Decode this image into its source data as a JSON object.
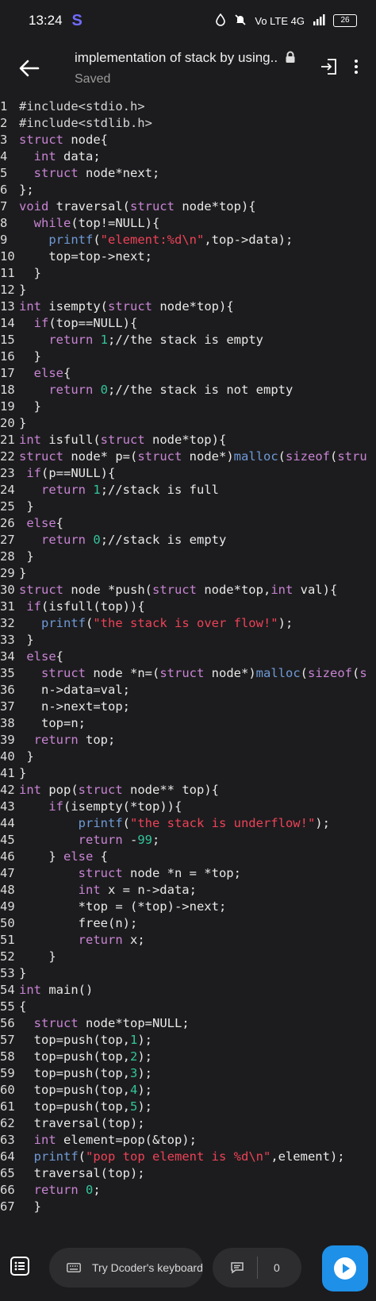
{
  "status": {
    "time": "13:24",
    "brand": "S",
    "network": "Vo LTE 4G",
    "battery": "26"
  },
  "header": {
    "title": "implementation of stack by using..",
    "subtitle": "Saved"
  },
  "icons": {
    "back": "arrow-left-icon",
    "lock": "lock-icon",
    "enter": "login-icon",
    "more": "more-vert-icon",
    "menu": "list-icon",
    "keyboard": "keyboard-icon",
    "comment": "comment-icon",
    "run": "play-icon"
  },
  "code_lines": [
    {
      "n": "1",
      "t": [
        [
          "c",
          "#include<stdio.h>"
        ]
      ]
    },
    {
      "n": "2",
      "t": [
        [
          "c",
          "#include<stdlib.h>"
        ]
      ]
    },
    {
      "n": "3",
      "t": [
        [
          "k",
          "struct"
        ],
        [
          "p",
          " node{"
        ]
      ]
    },
    {
      "n": "4",
      "t": [
        [
          "p",
          "  "
        ],
        [
          "k",
          "int"
        ],
        [
          "p",
          " data;"
        ]
      ]
    },
    {
      "n": "5",
      "t": [
        [
          "p",
          "  "
        ],
        [
          "k",
          "struct"
        ],
        [
          "p",
          " node*next;"
        ]
      ]
    },
    {
      "n": "6",
      "t": [
        [
          "p",
          "};"
        ]
      ]
    },
    {
      "n": "7",
      "t": [
        [
          "k",
          "void"
        ],
        [
          "p",
          " traversal("
        ],
        [
          "k",
          "struct"
        ],
        [
          "p",
          " node*top){"
        ]
      ]
    },
    {
      "n": "8",
      "t": [
        [
          "p",
          "  "
        ],
        [
          "k",
          "while"
        ],
        [
          "p",
          "(top!=NULL){"
        ]
      ]
    },
    {
      "n": "9",
      "t": [
        [
          "p",
          "    "
        ],
        [
          "f",
          "printf"
        ],
        [
          "p",
          "("
        ],
        [
          "s",
          "\"element:%d\\n\""
        ],
        [
          "p",
          ",top->data);"
        ]
      ]
    },
    {
      "n": "10",
      "t": [
        [
          "p",
          "    top=top->next;"
        ]
      ]
    },
    {
      "n": "11",
      "t": [
        [
          "p",
          "  }"
        ]
      ]
    },
    {
      "n": "12",
      "t": [
        [
          "p",
          "}"
        ]
      ]
    },
    {
      "n": "13",
      "t": [
        [
          "k",
          "int"
        ],
        [
          "p",
          " isempty("
        ],
        [
          "k",
          "struct"
        ],
        [
          "p",
          " node*top){"
        ]
      ]
    },
    {
      "n": "14",
      "t": [
        [
          "p",
          "  "
        ],
        [
          "k",
          "if"
        ],
        [
          "p",
          "(top==NULL){"
        ]
      ]
    },
    {
      "n": "15",
      "t": [
        [
          "p",
          "    "
        ],
        [
          "k",
          "return"
        ],
        [
          "p",
          " "
        ],
        [
          "n",
          "1"
        ],
        [
          "p",
          ";//the stack is empty"
        ]
      ]
    },
    {
      "n": "16",
      "t": [
        [
          "p",
          "  }"
        ]
      ]
    },
    {
      "n": "17",
      "t": [
        [
          "p",
          "  "
        ],
        [
          "k",
          "else"
        ],
        [
          "p",
          "{"
        ]
      ]
    },
    {
      "n": "18",
      "t": [
        [
          "p",
          "    "
        ],
        [
          "k",
          "return"
        ],
        [
          "p",
          " "
        ],
        [
          "n",
          "0"
        ],
        [
          "p",
          ";//the stack is not empty"
        ]
      ]
    },
    {
      "n": "19",
      "t": [
        [
          "p",
          "  }"
        ]
      ]
    },
    {
      "n": "20",
      "t": [
        [
          "p",
          "}"
        ]
      ]
    },
    {
      "n": "21",
      "t": [
        [
          "k",
          "int"
        ],
        [
          "p",
          " isfull("
        ],
        [
          "k",
          "struct"
        ],
        [
          "p",
          " node*top){"
        ]
      ]
    },
    {
      "n": "22",
      "t": [
        [
          "k",
          "struct"
        ],
        [
          "p",
          " node* p=("
        ],
        [
          "k",
          "struct"
        ],
        [
          "p",
          " node*)"
        ],
        [
          "f",
          "malloc"
        ],
        [
          "p",
          "("
        ],
        [
          "k",
          "sizeof"
        ],
        [
          "p",
          "("
        ],
        [
          "k",
          "stru"
        ]
      ]
    },
    {
      "n": "23",
      "t": [
        [
          "p",
          " "
        ],
        [
          "k",
          "if"
        ],
        [
          "p",
          "(p==NULL){"
        ]
      ]
    },
    {
      "n": "24",
      "t": [
        [
          "p",
          "   "
        ],
        [
          "k",
          "return"
        ],
        [
          "p",
          " "
        ],
        [
          "n",
          "1"
        ],
        [
          "p",
          ";//stack is full"
        ]
      ]
    },
    {
      "n": "25",
      "t": [
        [
          "p",
          " }"
        ]
      ]
    },
    {
      "n": "26",
      "t": [
        [
          "p",
          " "
        ],
        [
          "k",
          "else"
        ],
        [
          "p",
          "{"
        ]
      ]
    },
    {
      "n": "27",
      "t": [
        [
          "p",
          "   "
        ],
        [
          "k",
          "return"
        ],
        [
          "p",
          " "
        ],
        [
          "n",
          "0"
        ],
        [
          "p",
          ";//stack is empty"
        ]
      ]
    },
    {
      "n": "28",
      "t": [
        [
          "p",
          " }"
        ]
      ]
    },
    {
      "n": "29",
      "t": [
        [
          "p",
          "}"
        ]
      ]
    },
    {
      "n": "30",
      "t": [
        [
          "k",
          "struct"
        ],
        [
          "p",
          " node *push("
        ],
        [
          "k",
          "struct"
        ],
        [
          "p",
          " node*top,"
        ],
        [
          "k",
          "int"
        ],
        [
          "p",
          " val){"
        ]
      ]
    },
    {
      "n": "31",
      "t": [
        [
          "p",
          " "
        ],
        [
          "k",
          "if"
        ],
        [
          "p",
          "(isfull(top)){"
        ]
      ]
    },
    {
      "n": "32",
      "t": [
        [
          "p",
          "   "
        ],
        [
          "f",
          "printf"
        ],
        [
          "p",
          "("
        ],
        [
          "s",
          "\"the stack is over flow!\""
        ],
        [
          "p",
          ");"
        ]
      ]
    },
    {
      "n": "33",
      "t": [
        [
          "p",
          " }"
        ]
      ]
    },
    {
      "n": "34",
      "t": [
        [
          "p",
          " "
        ],
        [
          "k",
          "else"
        ],
        [
          "p",
          "{"
        ]
      ]
    },
    {
      "n": "35",
      "t": [
        [
          "p",
          "   "
        ],
        [
          "k",
          "struct"
        ],
        [
          "p",
          " node *n=("
        ],
        [
          "k",
          "struct"
        ],
        [
          "p",
          " node*)"
        ],
        [
          "f",
          "malloc"
        ],
        [
          "p",
          "("
        ],
        [
          "k",
          "sizeof"
        ],
        [
          "p",
          "("
        ],
        [
          "k",
          "s"
        ]
      ]
    },
    {
      "n": "36",
      "t": [
        [
          "p",
          "   n->data=val;"
        ]
      ]
    },
    {
      "n": "37",
      "t": [
        [
          "p",
          "   n->next=top;"
        ]
      ]
    },
    {
      "n": "38",
      "t": [
        [
          "p",
          "   top=n;"
        ]
      ]
    },
    {
      "n": "39",
      "t": [
        [
          "p",
          "  "
        ],
        [
          "k",
          "return"
        ],
        [
          "p",
          " top;"
        ]
      ]
    },
    {
      "n": "40",
      "t": [
        [
          "p",
          " }"
        ]
      ]
    },
    {
      "n": "41",
      "t": [
        [
          "p",
          "}"
        ]
      ]
    },
    {
      "n": "42",
      "t": [
        [
          "k",
          "int"
        ],
        [
          "p",
          " pop("
        ],
        [
          "k",
          "struct"
        ],
        [
          "p",
          " node** top){"
        ]
      ]
    },
    {
      "n": "43",
      "t": [
        [
          "p",
          "    "
        ],
        [
          "k",
          "if"
        ],
        [
          "p",
          "(isempty(*top)){"
        ]
      ]
    },
    {
      "n": "44",
      "t": [
        [
          "p",
          "        "
        ],
        [
          "f",
          "printf"
        ],
        [
          "p",
          "("
        ],
        [
          "s",
          "\"the stack is underflow!\""
        ],
        [
          "p",
          ");"
        ]
      ]
    },
    {
      "n": "45",
      "t": [
        [
          "p",
          "        "
        ],
        [
          "k",
          "return"
        ],
        [
          "p",
          " -"
        ],
        [
          "n",
          "99"
        ],
        [
          "p",
          ";"
        ]
      ]
    },
    {
      "n": "46",
      "t": [
        [
          "p",
          "    } "
        ],
        [
          "k",
          "else"
        ],
        [
          "p",
          " {"
        ]
      ]
    },
    {
      "n": "47",
      "t": [
        [
          "p",
          "        "
        ],
        [
          "k",
          "struct"
        ],
        [
          "p",
          " node *n = *top;"
        ]
      ]
    },
    {
      "n": "48",
      "t": [
        [
          "p",
          "        "
        ],
        [
          "k",
          "int"
        ],
        [
          "p",
          " x = n->data;"
        ]
      ]
    },
    {
      "n": "49",
      "t": [
        [
          "p",
          "        *top = (*top)->next;"
        ]
      ]
    },
    {
      "n": "50",
      "t": [
        [
          "p",
          "        free(n);"
        ]
      ]
    },
    {
      "n": "51",
      "t": [
        [
          "p",
          "        "
        ],
        [
          "k",
          "return"
        ],
        [
          "p",
          " x;"
        ]
      ]
    },
    {
      "n": "52",
      "t": [
        [
          "p",
          "    }"
        ]
      ]
    },
    {
      "n": "53",
      "t": [
        [
          "p",
          "}"
        ]
      ]
    },
    {
      "n": "54",
      "t": [
        [
          "k",
          "int"
        ],
        [
          "p",
          " main()"
        ]
      ]
    },
    {
      "n": "55",
      "t": [
        [
          "p",
          "{"
        ]
      ]
    },
    {
      "n": "56",
      "t": [
        [
          "p",
          "  "
        ],
        [
          "k",
          "struct"
        ],
        [
          "p",
          " node*top=NULL;"
        ]
      ]
    },
    {
      "n": "57",
      "t": [
        [
          "p",
          "  top=push(top,"
        ],
        [
          "n",
          "1"
        ],
        [
          "p",
          ");"
        ]
      ]
    },
    {
      "n": "58",
      "t": [
        [
          "p",
          "  top=push(top,"
        ],
        [
          "n",
          "2"
        ],
        [
          "p",
          ");"
        ]
      ]
    },
    {
      "n": "59",
      "t": [
        [
          "p",
          "  top=push(top,"
        ],
        [
          "n",
          "3"
        ],
        [
          "p",
          ");"
        ]
      ]
    },
    {
      "n": "60",
      "t": [
        [
          "p",
          "  top=push(top,"
        ],
        [
          "n",
          "4"
        ],
        [
          "p",
          ");"
        ]
      ]
    },
    {
      "n": "61",
      "t": [
        [
          "p",
          "  top=push(top,"
        ],
        [
          "n",
          "5"
        ],
        [
          "p",
          ");"
        ]
      ]
    },
    {
      "n": "62",
      "t": [
        [
          "p",
          "  traversal(top);"
        ]
      ]
    },
    {
      "n": "63",
      "t": [
        [
          "p",
          "  "
        ],
        [
          "k",
          "int"
        ],
        [
          "p",
          " element=pop(&top);"
        ]
      ]
    },
    {
      "n": "64",
      "t": [
        [
          "p",
          "  "
        ],
        [
          "f",
          "printf"
        ],
        [
          "p",
          "("
        ],
        [
          "s",
          "\"pop top element is %d\\n\""
        ],
        [
          "p",
          ",element);"
        ]
      ]
    },
    {
      "n": "65",
      "t": [
        [
          "p",
          "  traversal(top);"
        ]
      ]
    },
    {
      "n": "66",
      "t": [
        [
          "p",
          "  "
        ],
        [
          "k",
          "return"
        ],
        [
          "p",
          " "
        ],
        [
          "n",
          "0"
        ],
        [
          "p",
          ";"
        ]
      ]
    },
    {
      "n": "67",
      "t": [
        [
          "p",
          "  }"
        ]
      ]
    }
  ],
  "bottom": {
    "keyboard_label": "Try Dcoder's keyboard",
    "comment_count": "0"
  }
}
